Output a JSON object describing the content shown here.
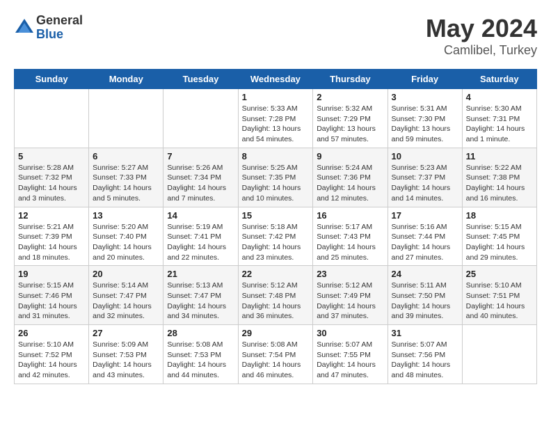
{
  "header": {
    "logo_general": "General",
    "logo_blue": "Blue",
    "title": "May 2024",
    "location": "Camlibel, Turkey"
  },
  "weekdays": [
    "Sunday",
    "Monday",
    "Tuesday",
    "Wednesday",
    "Thursday",
    "Friday",
    "Saturday"
  ],
  "weeks": [
    [
      {
        "day": "",
        "sunrise": "",
        "sunset": "",
        "daylight": ""
      },
      {
        "day": "",
        "sunrise": "",
        "sunset": "",
        "daylight": ""
      },
      {
        "day": "",
        "sunrise": "",
        "sunset": "",
        "daylight": ""
      },
      {
        "day": "1",
        "sunrise": "Sunrise: 5:33 AM",
        "sunset": "Sunset: 7:28 PM",
        "daylight": "Daylight: 13 hours and 54 minutes."
      },
      {
        "day": "2",
        "sunrise": "Sunrise: 5:32 AM",
        "sunset": "Sunset: 7:29 PM",
        "daylight": "Daylight: 13 hours and 57 minutes."
      },
      {
        "day": "3",
        "sunrise": "Sunrise: 5:31 AM",
        "sunset": "Sunset: 7:30 PM",
        "daylight": "Daylight: 13 hours and 59 minutes."
      },
      {
        "day": "4",
        "sunrise": "Sunrise: 5:30 AM",
        "sunset": "Sunset: 7:31 PM",
        "daylight": "Daylight: 14 hours and 1 minute."
      }
    ],
    [
      {
        "day": "5",
        "sunrise": "Sunrise: 5:28 AM",
        "sunset": "Sunset: 7:32 PM",
        "daylight": "Daylight: 14 hours and 3 minutes."
      },
      {
        "day": "6",
        "sunrise": "Sunrise: 5:27 AM",
        "sunset": "Sunset: 7:33 PM",
        "daylight": "Daylight: 14 hours and 5 minutes."
      },
      {
        "day": "7",
        "sunrise": "Sunrise: 5:26 AM",
        "sunset": "Sunset: 7:34 PM",
        "daylight": "Daylight: 14 hours and 7 minutes."
      },
      {
        "day": "8",
        "sunrise": "Sunrise: 5:25 AM",
        "sunset": "Sunset: 7:35 PM",
        "daylight": "Daylight: 14 hours and 10 minutes."
      },
      {
        "day": "9",
        "sunrise": "Sunrise: 5:24 AM",
        "sunset": "Sunset: 7:36 PM",
        "daylight": "Daylight: 14 hours and 12 minutes."
      },
      {
        "day": "10",
        "sunrise": "Sunrise: 5:23 AM",
        "sunset": "Sunset: 7:37 PM",
        "daylight": "Daylight: 14 hours and 14 minutes."
      },
      {
        "day": "11",
        "sunrise": "Sunrise: 5:22 AM",
        "sunset": "Sunset: 7:38 PM",
        "daylight": "Daylight: 14 hours and 16 minutes."
      }
    ],
    [
      {
        "day": "12",
        "sunrise": "Sunrise: 5:21 AM",
        "sunset": "Sunset: 7:39 PM",
        "daylight": "Daylight: 14 hours and 18 minutes."
      },
      {
        "day": "13",
        "sunrise": "Sunrise: 5:20 AM",
        "sunset": "Sunset: 7:40 PM",
        "daylight": "Daylight: 14 hours and 20 minutes."
      },
      {
        "day": "14",
        "sunrise": "Sunrise: 5:19 AM",
        "sunset": "Sunset: 7:41 PM",
        "daylight": "Daylight: 14 hours and 22 minutes."
      },
      {
        "day": "15",
        "sunrise": "Sunrise: 5:18 AM",
        "sunset": "Sunset: 7:42 PM",
        "daylight": "Daylight: 14 hours and 23 minutes."
      },
      {
        "day": "16",
        "sunrise": "Sunrise: 5:17 AM",
        "sunset": "Sunset: 7:43 PM",
        "daylight": "Daylight: 14 hours and 25 minutes."
      },
      {
        "day": "17",
        "sunrise": "Sunrise: 5:16 AM",
        "sunset": "Sunset: 7:44 PM",
        "daylight": "Daylight: 14 hours and 27 minutes."
      },
      {
        "day": "18",
        "sunrise": "Sunrise: 5:15 AM",
        "sunset": "Sunset: 7:45 PM",
        "daylight": "Daylight: 14 hours and 29 minutes."
      }
    ],
    [
      {
        "day": "19",
        "sunrise": "Sunrise: 5:15 AM",
        "sunset": "Sunset: 7:46 PM",
        "daylight": "Daylight: 14 hours and 31 minutes."
      },
      {
        "day": "20",
        "sunrise": "Sunrise: 5:14 AM",
        "sunset": "Sunset: 7:47 PM",
        "daylight": "Daylight: 14 hours and 32 minutes."
      },
      {
        "day": "21",
        "sunrise": "Sunrise: 5:13 AM",
        "sunset": "Sunset: 7:47 PM",
        "daylight": "Daylight: 14 hours and 34 minutes."
      },
      {
        "day": "22",
        "sunrise": "Sunrise: 5:12 AM",
        "sunset": "Sunset: 7:48 PM",
        "daylight": "Daylight: 14 hours and 36 minutes."
      },
      {
        "day": "23",
        "sunrise": "Sunrise: 5:12 AM",
        "sunset": "Sunset: 7:49 PM",
        "daylight": "Daylight: 14 hours and 37 minutes."
      },
      {
        "day": "24",
        "sunrise": "Sunrise: 5:11 AM",
        "sunset": "Sunset: 7:50 PM",
        "daylight": "Daylight: 14 hours and 39 minutes."
      },
      {
        "day": "25",
        "sunrise": "Sunrise: 5:10 AM",
        "sunset": "Sunset: 7:51 PM",
        "daylight": "Daylight: 14 hours and 40 minutes."
      }
    ],
    [
      {
        "day": "26",
        "sunrise": "Sunrise: 5:10 AM",
        "sunset": "Sunset: 7:52 PM",
        "daylight": "Daylight: 14 hours and 42 minutes."
      },
      {
        "day": "27",
        "sunrise": "Sunrise: 5:09 AM",
        "sunset": "Sunset: 7:53 PM",
        "daylight": "Daylight: 14 hours and 43 minutes."
      },
      {
        "day": "28",
        "sunrise": "Sunrise: 5:08 AM",
        "sunset": "Sunset: 7:53 PM",
        "daylight": "Daylight: 14 hours and 44 minutes."
      },
      {
        "day": "29",
        "sunrise": "Sunrise: 5:08 AM",
        "sunset": "Sunset: 7:54 PM",
        "daylight": "Daylight: 14 hours and 46 minutes."
      },
      {
        "day": "30",
        "sunrise": "Sunrise: 5:07 AM",
        "sunset": "Sunset: 7:55 PM",
        "daylight": "Daylight: 14 hours and 47 minutes."
      },
      {
        "day": "31",
        "sunrise": "Sunrise: 5:07 AM",
        "sunset": "Sunset: 7:56 PM",
        "daylight": "Daylight: 14 hours and 48 minutes."
      },
      {
        "day": "",
        "sunrise": "",
        "sunset": "",
        "daylight": ""
      }
    ]
  ]
}
